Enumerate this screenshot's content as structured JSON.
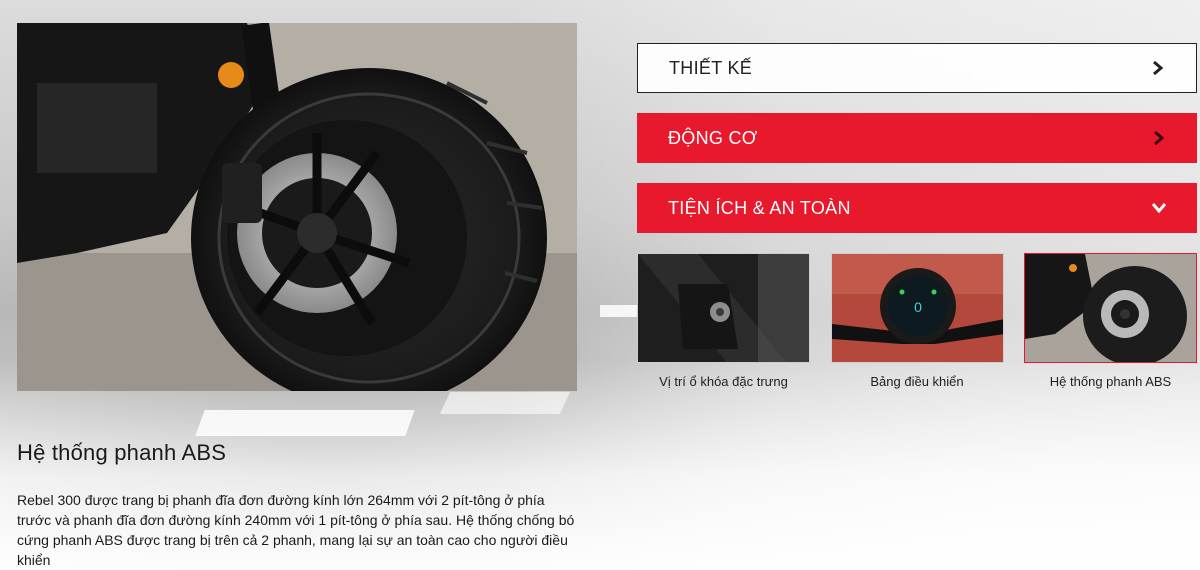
{
  "accordion": {
    "items": [
      {
        "label": "THIẾT KẾ",
        "state": "collapsed",
        "style": "outline",
        "icon": "chevron-right-icon"
      },
      {
        "label": "ĐỘNG CƠ",
        "state": "collapsed",
        "style": "red",
        "icon": "chevron-right-icon"
      },
      {
        "label": "TIỆN ÍCH & AN TOÀN",
        "state": "expanded",
        "style": "red",
        "icon": "chevron-down-icon"
      }
    ]
  },
  "gallery": {
    "thumbnails": [
      {
        "caption": "Vị trí ổ khóa đặc trưng",
        "icon": "ignition-lock-photo",
        "active": false
      },
      {
        "caption": "Bảng điều khiển",
        "icon": "dashboard-photo",
        "active": false
      },
      {
        "caption": "Hệ thống phanh ABS",
        "icon": "abs-brake-photo",
        "active": true
      }
    ]
  },
  "detail": {
    "title": "Hệ thống phanh ABS",
    "description": "Rebel 300 được trang bị phanh đĩa đơn đường kính lớn 264mm với 2 pít-tông ở phía trước và phanh đĩa đơn đường kính 240mm với 1 pít-tông ở phía sau. Hệ thống chống bó cứng phanh ABS được trang bị trên cả 2 phanh, mang lại sự an toàn cao cho người điều khiển"
  },
  "colors": {
    "accent": "#e8192c",
    "text": "#1a1a1a",
    "outline": "#222222"
  }
}
